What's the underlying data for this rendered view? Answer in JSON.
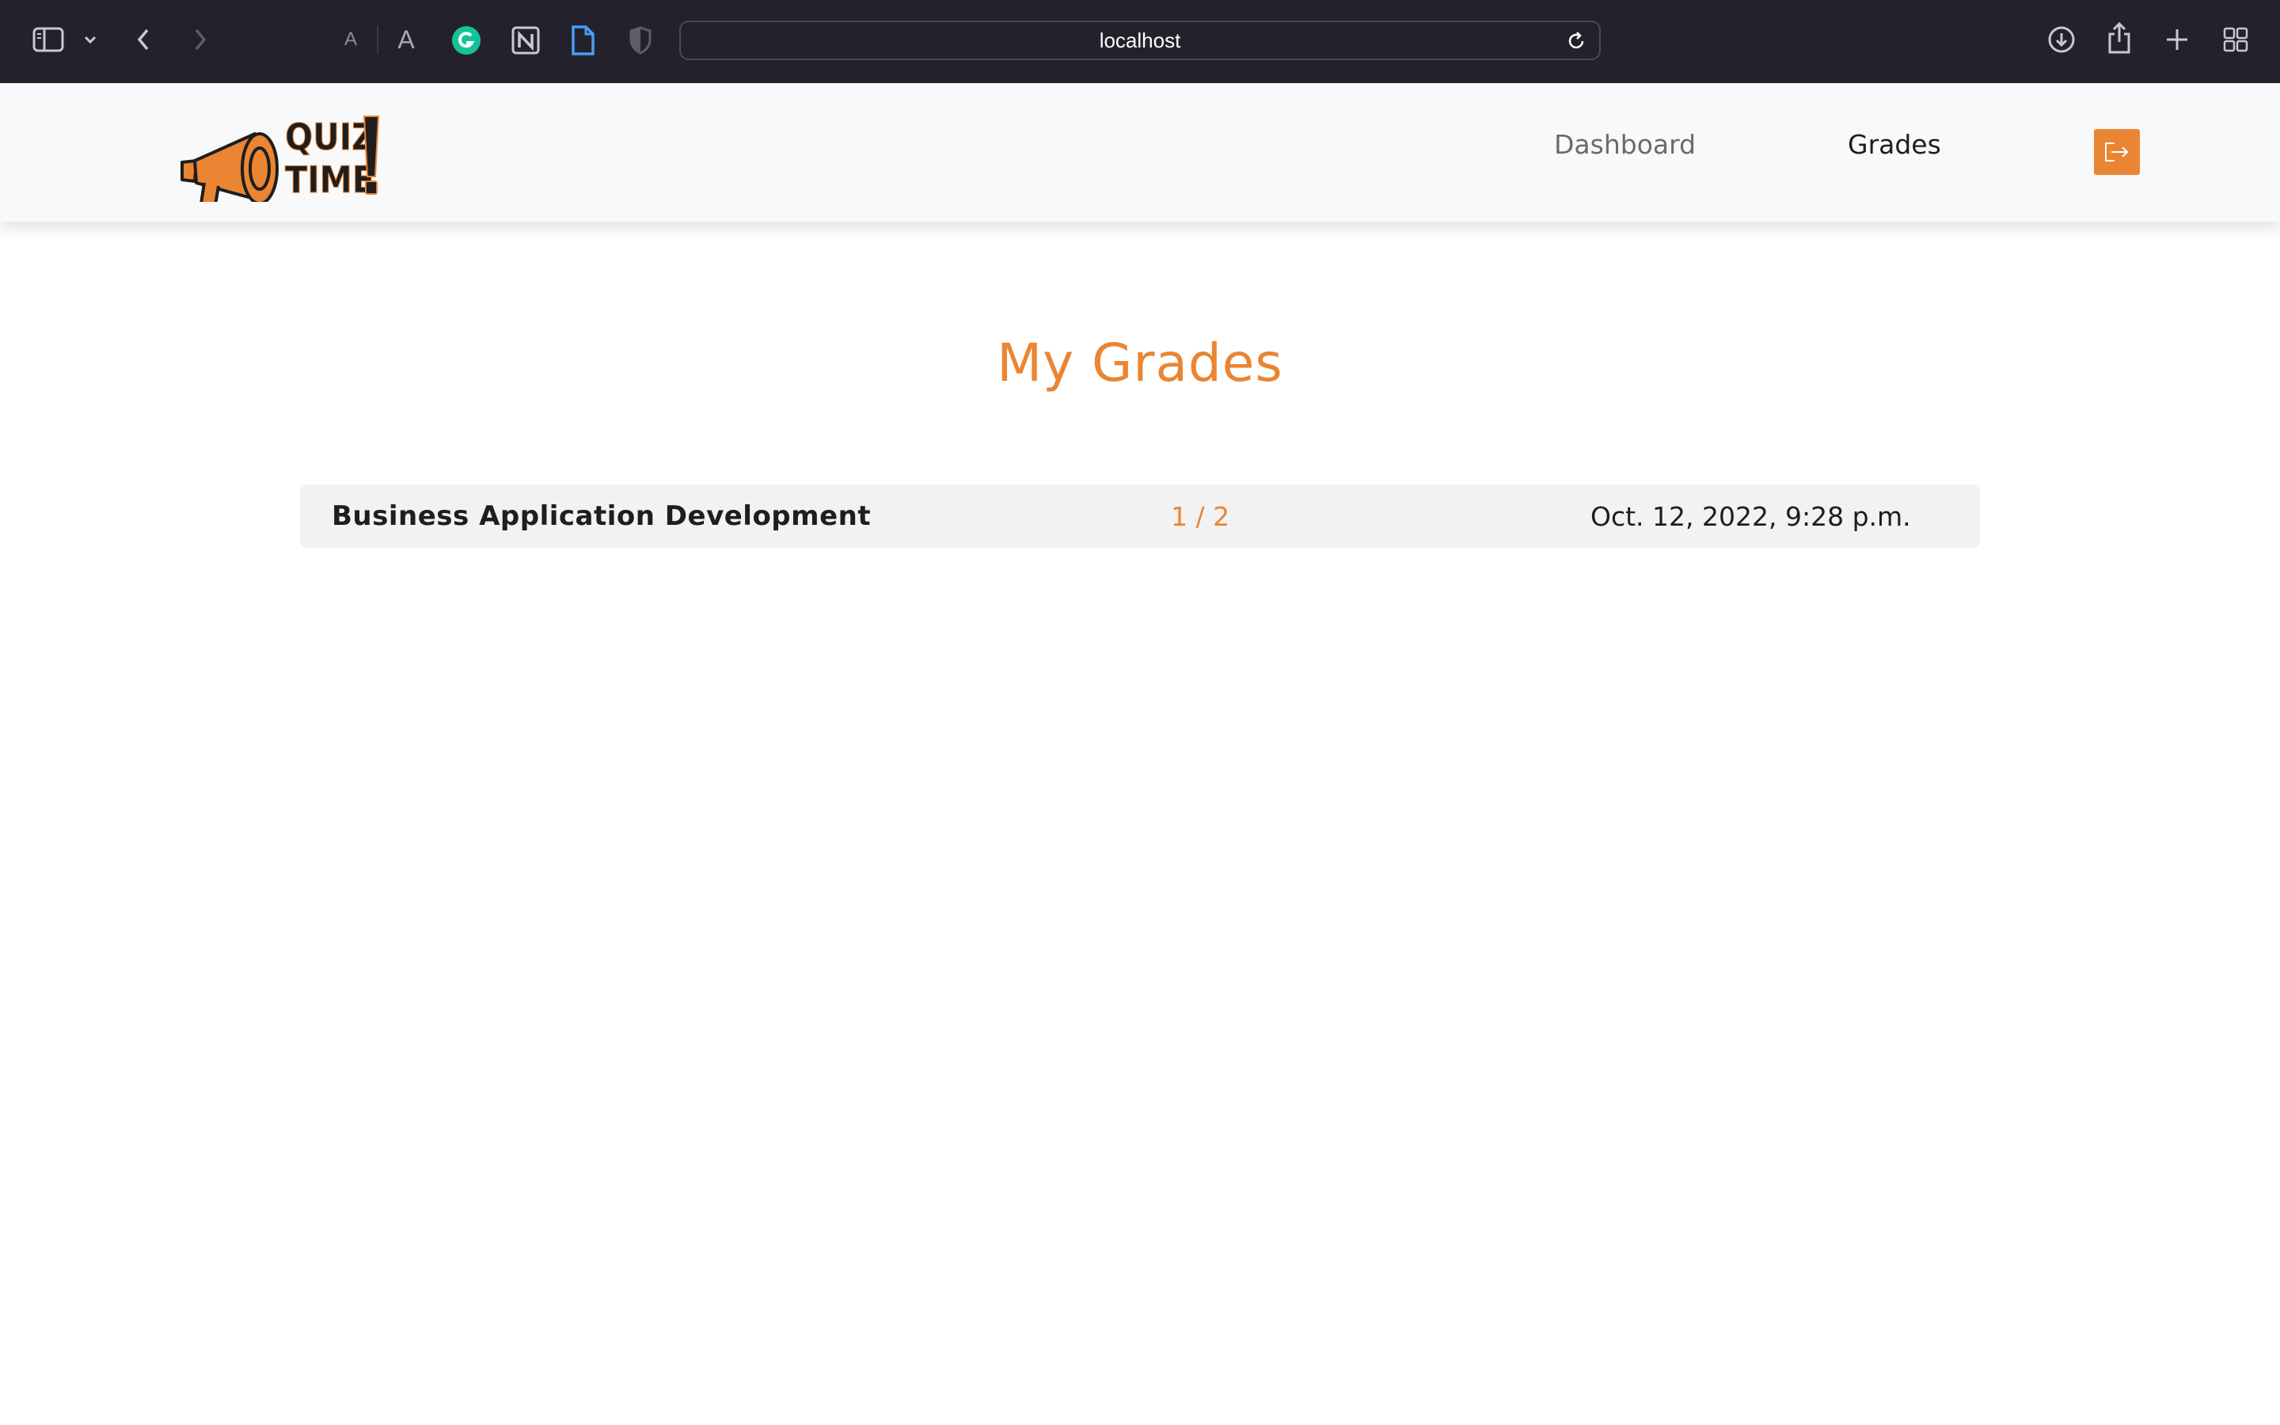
{
  "browser": {
    "url": "localhost",
    "font_small_label": "A",
    "font_large_label": "A"
  },
  "site": {
    "logo_text_line1": "QUIZ",
    "logo_text_line2": "TIME",
    "nav": {
      "dashboard_label": "Dashboard",
      "grades_label": "Grades"
    },
    "accent_color": "#ea8533"
  },
  "main": {
    "title": "My Grades",
    "grades": [
      {
        "course": "Business Application Development",
        "score": "1 / 2",
        "date": "Oct. 12, 2022, 9:28 p.m."
      }
    ]
  }
}
